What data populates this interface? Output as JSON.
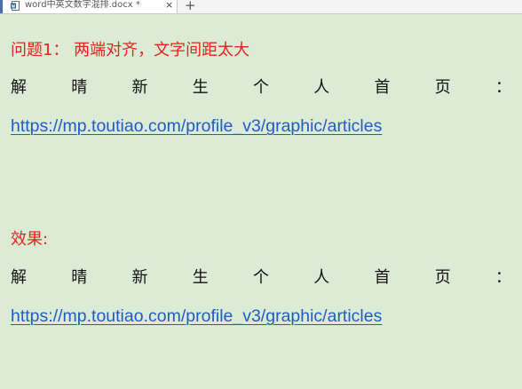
{
  "tab": {
    "title": "word中英文数字混排.docx *",
    "close_glyph": "×",
    "new_glyph": "+"
  },
  "document": {
    "problem_heading": "问题1： 两端对齐，文字间距太大",
    "row1_chars": [
      "解",
      "晴",
      "新",
      "生",
      "个",
      "人",
      "首",
      "页",
      "："
    ],
    "url1": "https://mp.toutiao.com/profile_v3/graphic/articles",
    "effect_heading": "效果:",
    "row2_chars": [
      "解",
      "晴",
      "新",
      "生",
      "个",
      "人",
      "首",
      "页",
      "："
    ],
    "url2": "https://mp.toutiao.com/profile_v3/graphic/articles"
  },
  "colors": {
    "background": "#dcebd5",
    "heading_red": "#e0241b",
    "link_blue": "#1f5cc4"
  },
  "icons": {
    "doc_icon": "word-document-icon"
  }
}
